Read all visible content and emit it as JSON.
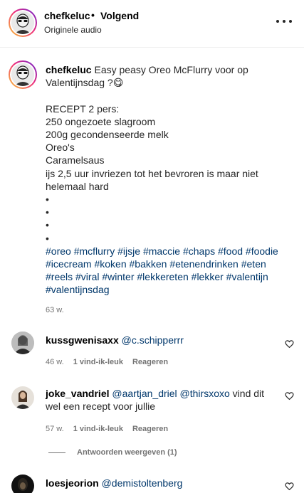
{
  "header": {
    "username": "chefkeluc",
    "separator": "•",
    "follow_label": "Volgend",
    "audio_label": "Originele audio"
  },
  "caption": {
    "username": "chefkeluc",
    "first_line": "Easy peasy Oreo McFlurry voor op Valentijnsdag ?😋",
    "lines": [
      "RECEPT 2 pers:",
      "250 ongezoete slagroom",
      "200g gecondenseerde melk",
      "Oreo's",
      "Caramelsaus",
      "ijs 2,5 uur invriezen tot het bevroren is maar niet helemaal hard",
      "•",
      "•",
      "•",
      "•"
    ],
    "hashtags": "#oreo #mcflurry #ijsje #maccie #chaps #food #foodie #icecream #koken #bakken #etenendrinken #eten #reels #viral #winter #lekkereten #lekker #valentijn #valentijnsdag",
    "time": "63 w."
  },
  "comments": [
    {
      "username": "kussgwenisaxx",
      "mention": "@c.schipperrr",
      "text": "",
      "time": "46 w.",
      "likes": "1 vind-ik-leuk",
      "reply_label": "Reageren"
    },
    {
      "username": "joke_vandriel",
      "mention": "@aartjan_driel @thirsxoxo",
      "text": " vind dit wel een recept voor jullie",
      "time": "57 w.",
      "likes": "1 vind-ik-leuk",
      "reply_label": "Reageren"
    },
    {
      "username": "loesjeorion",
      "mention": "@demistoltenberg",
      "text": ""
    }
  ],
  "view_replies_label": "Antwoorden weergeven (1)"
}
